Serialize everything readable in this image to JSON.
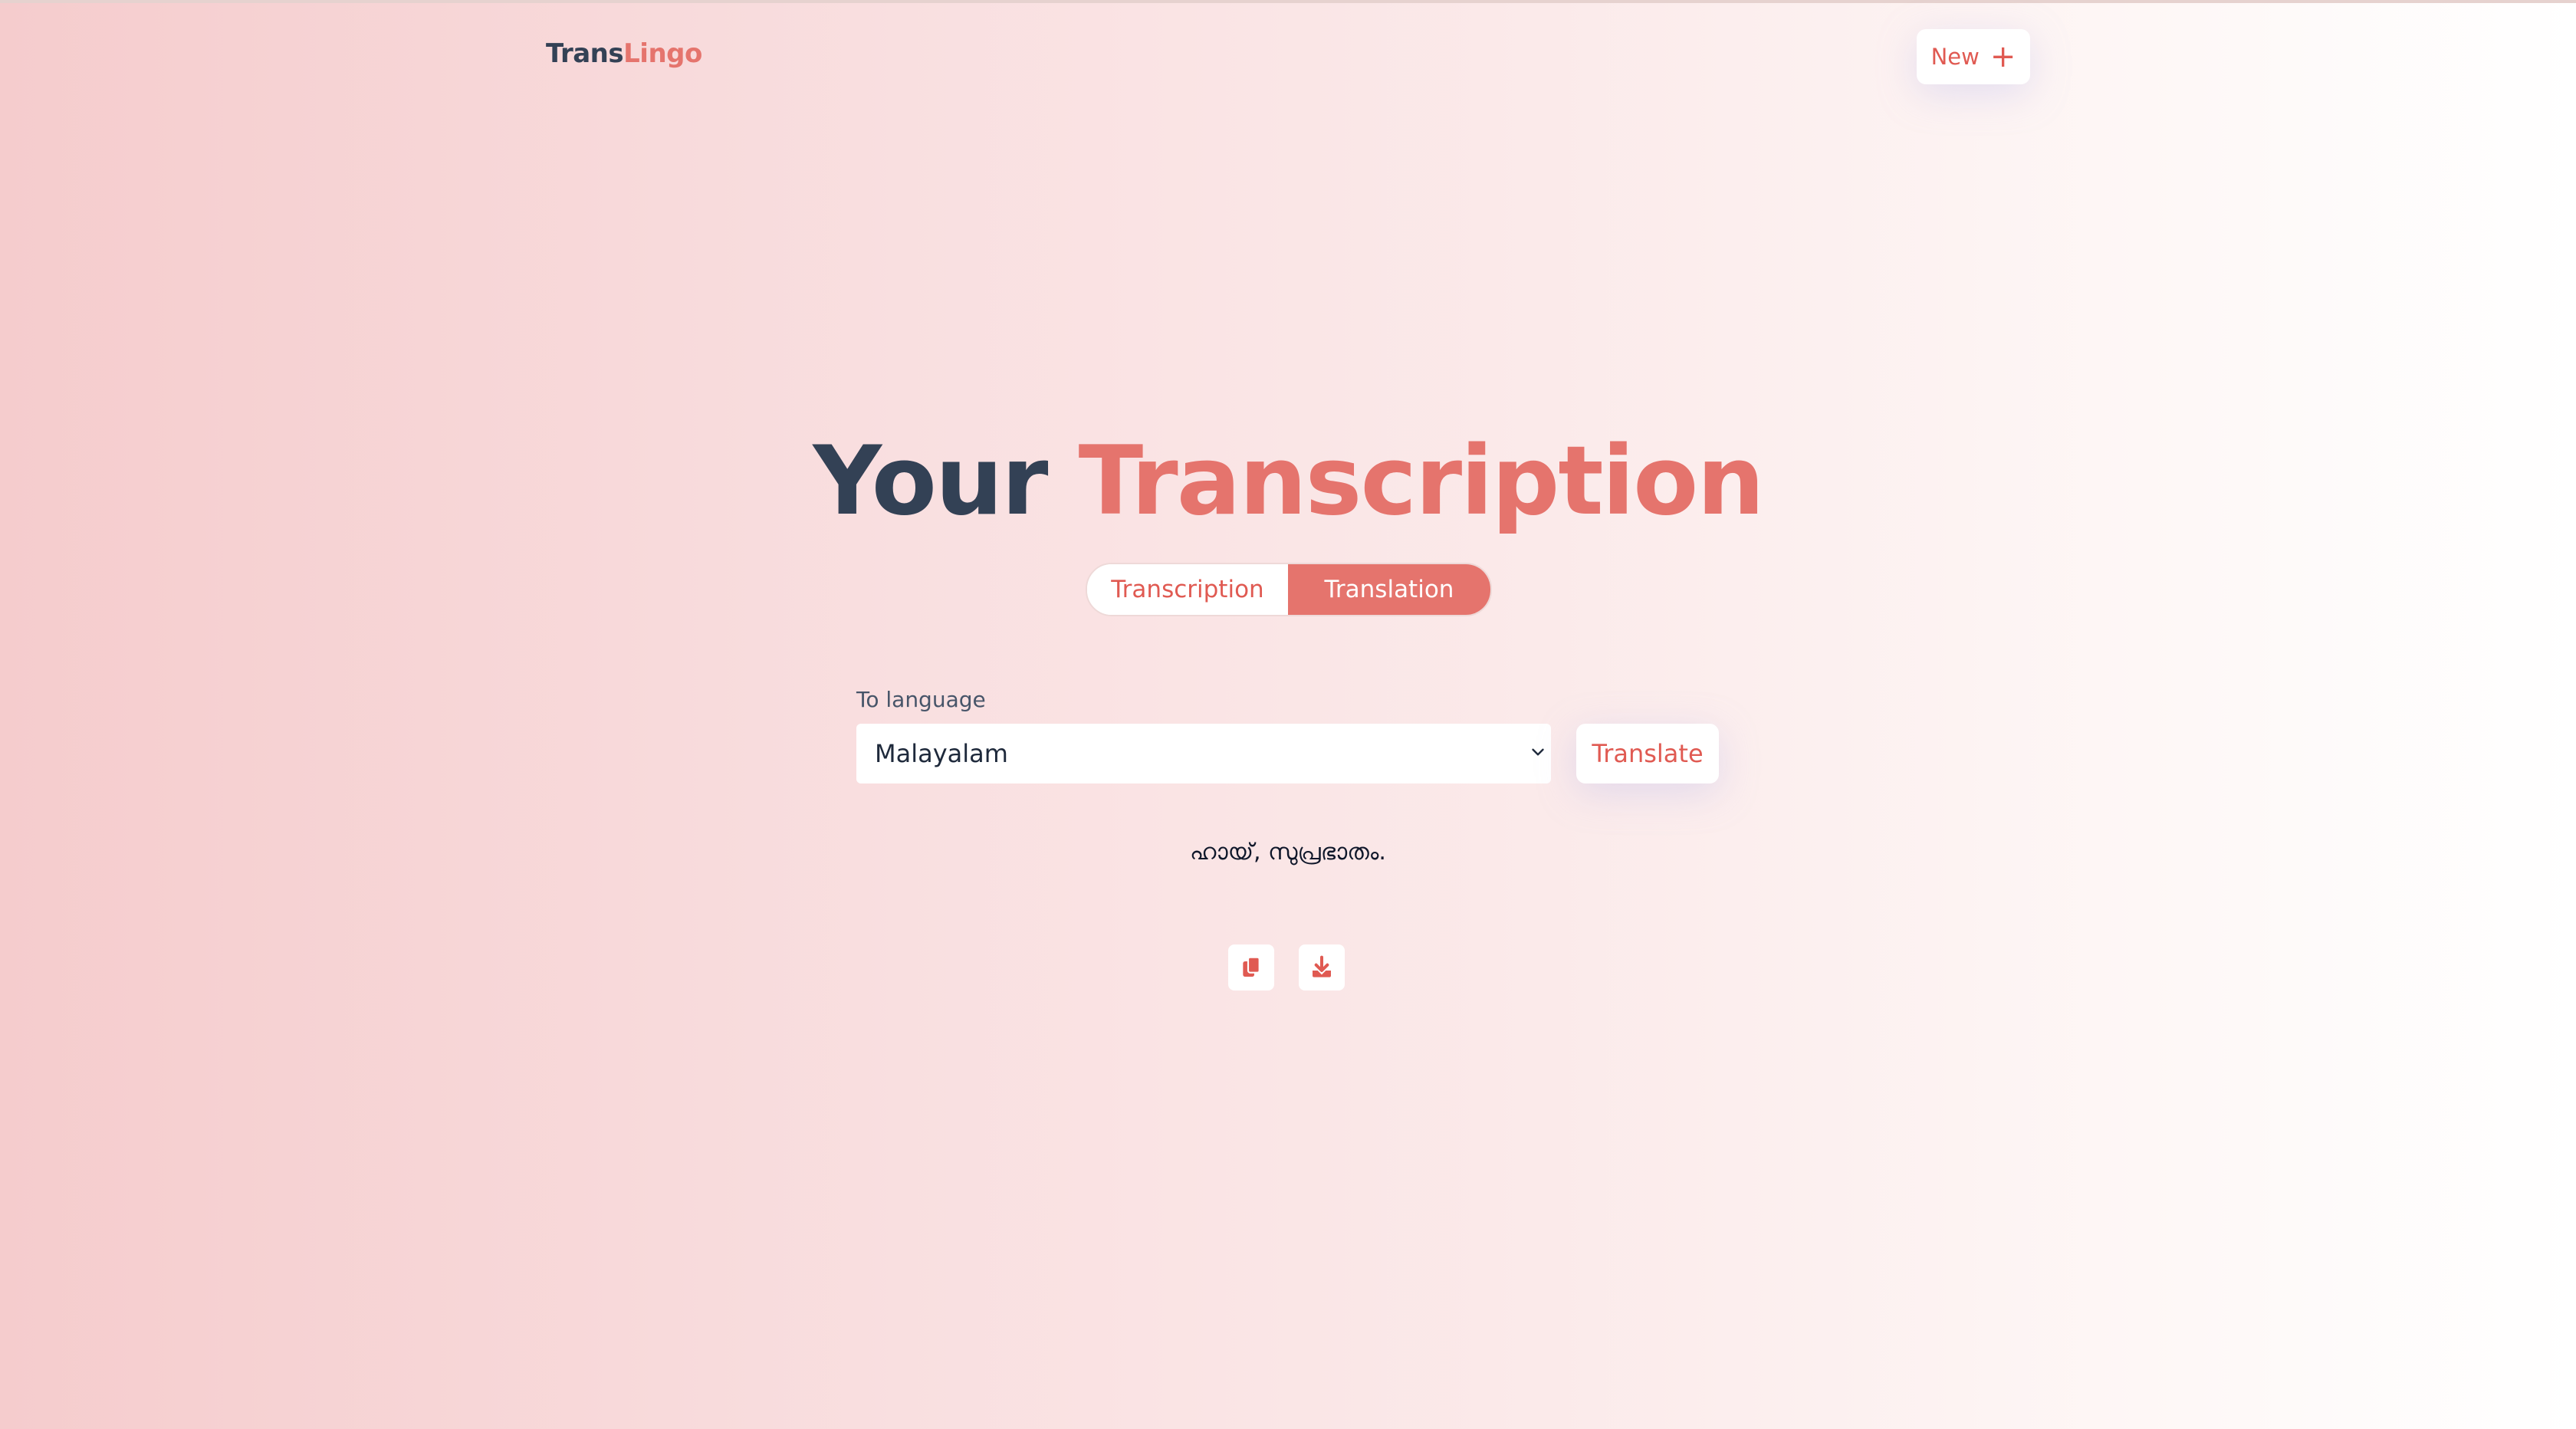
{
  "header": {
    "logo_part1": "Trans",
    "logo_part2": "Lingo",
    "new_button_label": "New",
    "new_button_icon": "plus-icon"
  },
  "title": {
    "part1": "Your",
    "part2": "Transcription"
  },
  "tabs": [
    {
      "label": "Transcription",
      "active": false
    },
    {
      "label": "Translation",
      "active": true
    }
  ],
  "translate_form": {
    "label": "To language",
    "selected_language": "Malayalam",
    "button_label": "Translate"
  },
  "output": {
    "text": "ഹായ്, സുപ്രഭാതം."
  },
  "actions": [
    {
      "name": "copy",
      "icon": "copy-icon"
    },
    {
      "name": "download",
      "icon": "download-icon"
    }
  ],
  "colors": {
    "accent": "#e5746d",
    "accent_dark": "#e05a52",
    "heading_dark": "#334155",
    "background_start": "#f5cccd",
    "background_end": "#ffffff"
  }
}
